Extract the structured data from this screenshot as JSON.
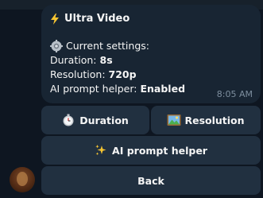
{
  "message": {
    "title": "Ultra Video",
    "title_icon": "lightning-bolt",
    "settings_header": "Current settings:",
    "settings_icon": "gear",
    "duration_label": "Duration:",
    "duration_value": "8s",
    "resolution_label": "Resolution:",
    "resolution_value": "720p",
    "ai_label": "AI prompt helper:",
    "ai_value": "Enabled",
    "time": "8:05 AM"
  },
  "buttons": {
    "duration": "Duration",
    "duration_icon": "stopwatch",
    "resolution": "Resolution",
    "resolution_icon": "landscape-picture",
    "ai_helper": "AI prompt helper",
    "ai_helper_icon": "sparkles",
    "back": "Back"
  },
  "colors": {
    "background": "#0e1621",
    "bubble": "#182533",
    "button": "#213040",
    "time_text": "#7d8e9e"
  }
}
